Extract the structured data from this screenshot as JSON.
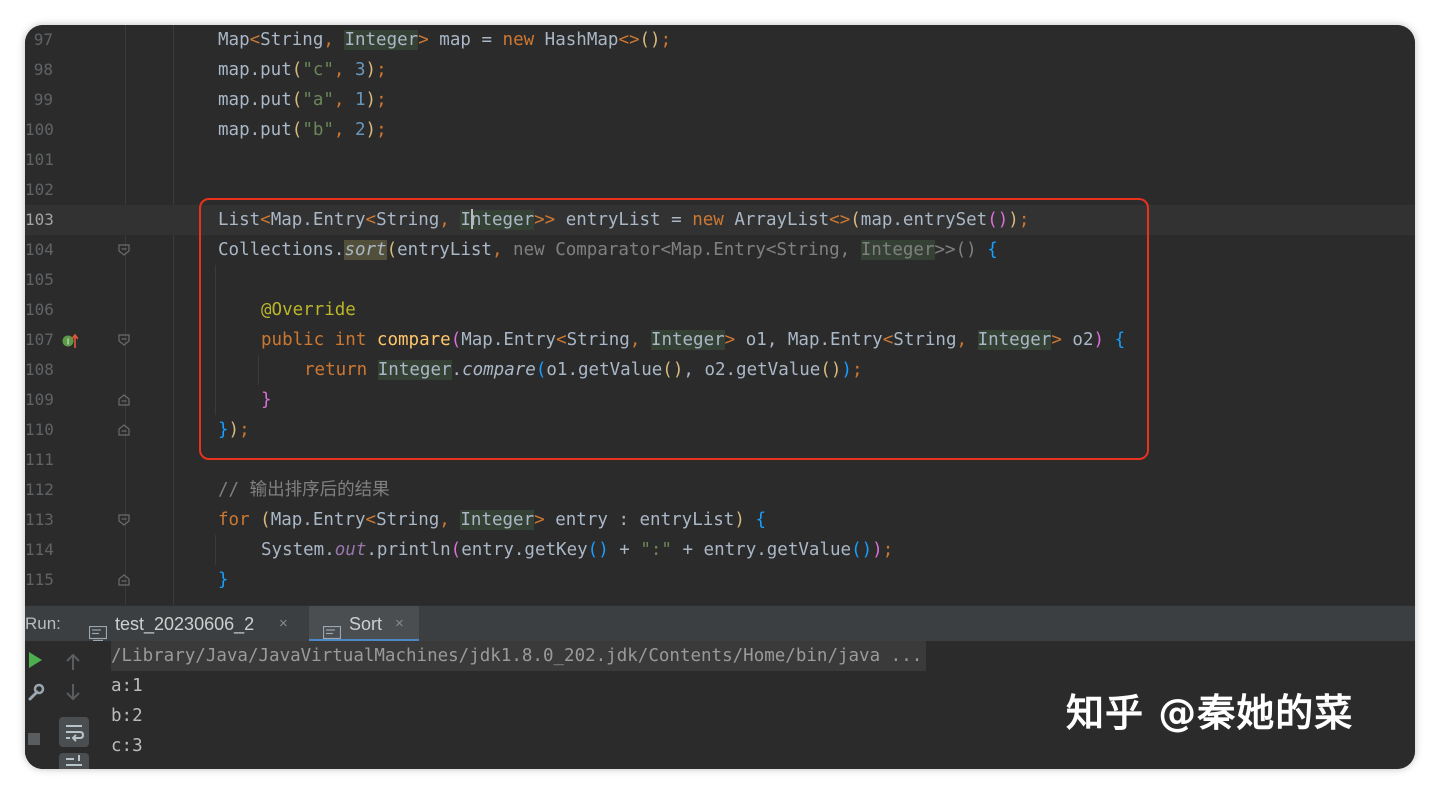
{
  "editor": {
    "lines": [
      {
        "n": "97"
      },
      {
        "n": "98"
      },
      {
        "n": "99"
      },
      {
        "n": "100"
      },
      {
        "n": "101"
      },
      {
        "n": "102"
      },
      {
        "n": "103"
      },
      {
        "n": "104"
      },
      {
        "n": "105"
      },
      {
        "n": "106"
      },
      {
        "n": "107"
      },
      {
        "n": "108"
      },
      {
        "n": "109"
      },
      {
        "n": "110"
      },
      {
        "n": "111"
      },
      {
        "n": "112"
      },
      {
        "n": "113"
      },
      {
        "n": "114"
      },
      {
        "n": "115"
      }
    ],
    "code": {
      "l97": {
        "a": "Map",
        "b": "<",
        "c": "String",
        "d": ", ",
        "e": "Integer",
        "f": ">",
        "g": " map = ",
        "h": "new",
        "i": " HashMap",
        "j": "<>",
        "k": "()",
        "l": ";"
      },
      "l98": {
        "a": "map.put",
        "b": "(",
        "c": "\"c\"",
        "d": ", ",
        "e": "3",
        "f": ")",
        "g": ";"
      },
      "l99": {
        "a": "map.put",
        "b": "(",
        "c": "\"a\"",
        "d": ", ",
        "e": "1",
        "f": ")",
        "g": ";"
      },
      "l100": {
        "a": "map.put",
        "b": "(",
        "c": "\"b\"",
        "d": ", ",
        "e": "2",
        "f": ")",
        "g": ";"
      },
      "l103": {
        "a": "List",
        "b": "<",
        "c": "Map.Entry",
        "d": "<",
        "e": "String",
        "f": ", ",
        "g1": "I",
        "g2": "nteger",
        "h": ">>",
        "i": " entryList = ",
        "j": "new",
        "k": " ArrayList",
        "l": "<>",
        "m": "(",
        "n": "map.entrySet",
        "o": "()",
        "p": ")",
        "q": ";"
      },
      "l104": {
        "a": "Collections.",
        "b": "sort",
        "c": "(",
        "d": "entryList",
        "e": ", ",
        "f": "new Comparator<Map.Entry<String, ",
        "g": "Integer",
        "h": ">>() ",
        "i": "{"
      },
      "l106": {
        "a": "@Override"
      },
      "l107": {
        "a": "public",
        "b": " ",
        "c": "int",
        "d": " ",
        "e": "compare",
        "f": "(",
        "g": "Map.Entry",
        "h": "<",
        "i": "String",
        "j": ", ",
        "k": "Integer",
        "l": ">",
        "m": " o1, Map.Entry",
        "n": "<",
        "o": "String",
        "p": ", ",
        "q": "Integer",
        "r": ">",
        "s": " o2",
        "t": ")",
        "u": " ",
        "v": "{"
      },
      "l108": {
        "a": "return",
        "b": " ",
        "c": "Integer",
        "d": ".",
        "e": "compare",
        "f": "(",
        "g": "o1.getValue",
        "h": "()",
        "i": ", o2.getValue",
        "j": "()",
        "k": ")",
        "l": ";"
      },
      "l109": {
        "a": "}"
      },
      "l110": {
        "a": "}",
        "b": ")",
        "c": ";"
      },
      "l112": {
        "a": "// 输出排序后的结果"
      },
      "l113": {
        "a": "for",
        "b": " ",
        "c": "(",
        "d": "Map.Entry",
        "e": "<",
        "f": "String",
        "g": ", ",
        "h": "Integer",
        "i": ">",
        "j": " entry : entryList",
        "k": ")",
        "l": " ",
        "m": "{"
      },
      "l114": {
        "a": "System.",
        "b": "out",
        "c": ".println",
        "d": "(",
        "e": "entry.getKey",
        "f": "()",
        "g": " + ",
        "h": "\":\"",
        "i": " + entry.getValue",
        "j": "()",
        "k": ")",
        "l": ";"
      },
      "l115": {
        "a": "}"
      }
    }
  },
  "run": {
    "label": "Run:",
    "tabs": [
      {
        "label": "test_20230606_2",
        "close": "×"
      },
      {
        "label": "Sort",
        "close": "×"
      }
    ]
  },
  "console": {
    "lines": [
      "/Library/Java/JavaVirtualMachines/jdk1.8.0_202.jdk/Contents/Home/bin/java ...",
      "a:1",
      "b:2",
      "c:3"
    ]
  },
  "watermark": "知乎 @秦她的菜",
  "colors": {
    "accent": "#4a88c7",
    "highlight_box": "#e8321e",
    "run_green": "#4caf50"
  }
}
